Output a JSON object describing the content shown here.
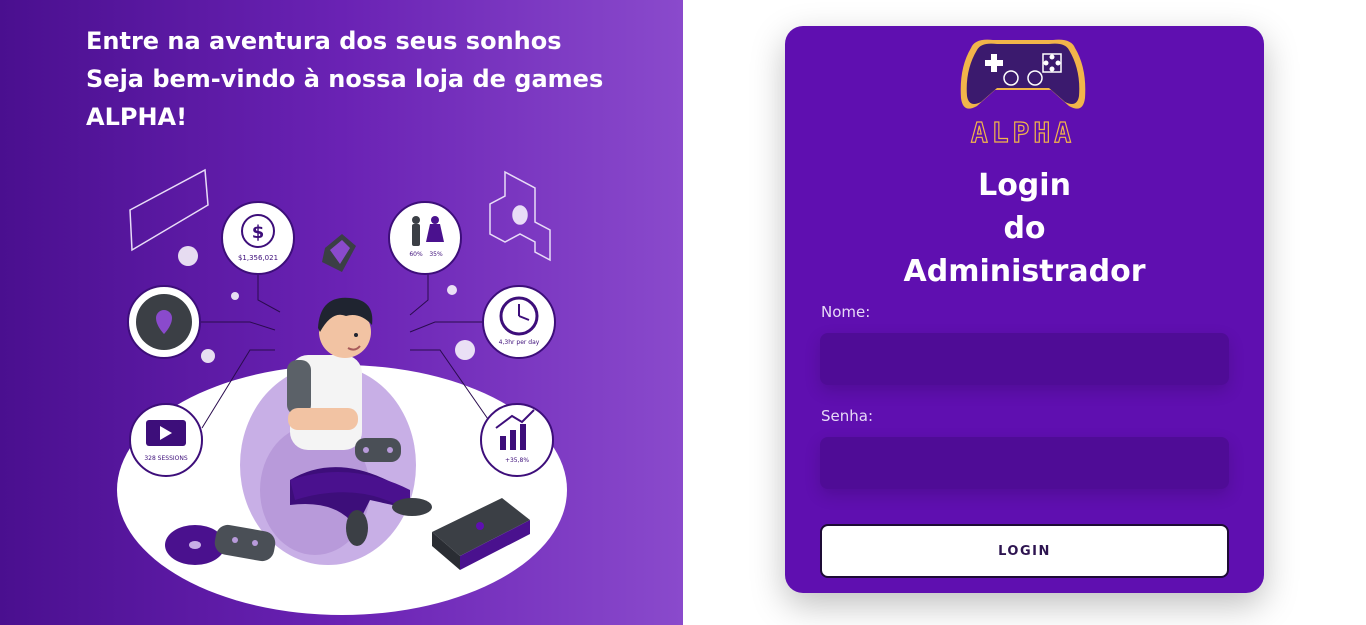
{
  "hero": {
    "line1": "Entre na aventura dos seus sonhos",
    "line2": "Seja bem-vindo à nossa loja de games",
    "line3": "ALPHA!"
  },
  "illustration": {
    "revenue": "$1,356,021",
    "male_pct": "60%",
    "female_pct": "35%",
    "time_per_day": "4,3hr per day",
    "sessions": "328 SESSIONS",
    "growth": "+35,8%"
  },
  "login": {
    "logo_text": "ALPHA",
    "title_line1": "Login",
    "title_line2": "do",
    "title_line3": "Administrador",
    "name_label": "Nome:",
    "name_value": "",
    "password_label": "Senha:",
    "password_value": "",
    "button_label": "LOGIN"
  },
  "colors": {
    "card_bg": "#5f0fb0",
    "input_bg": "#4f0c96",
    "accent_gold": "#f2b54a",
    "panel_gradient_start": "#4a0f8f",
    "panel_gradient_end": "#8a4acc"
  },
  "icons": [
    "gamepad-logo-icon",
    "dollar-icon",
    "location-pin-icon",
    "play-icon",
    "gender-icon",
    "clock-icon",
    "growth-chart-icon",
    "cherry-icon",
    "heart-icon",
    "devil-icon",
    "dpad-icon"
  ]
}
